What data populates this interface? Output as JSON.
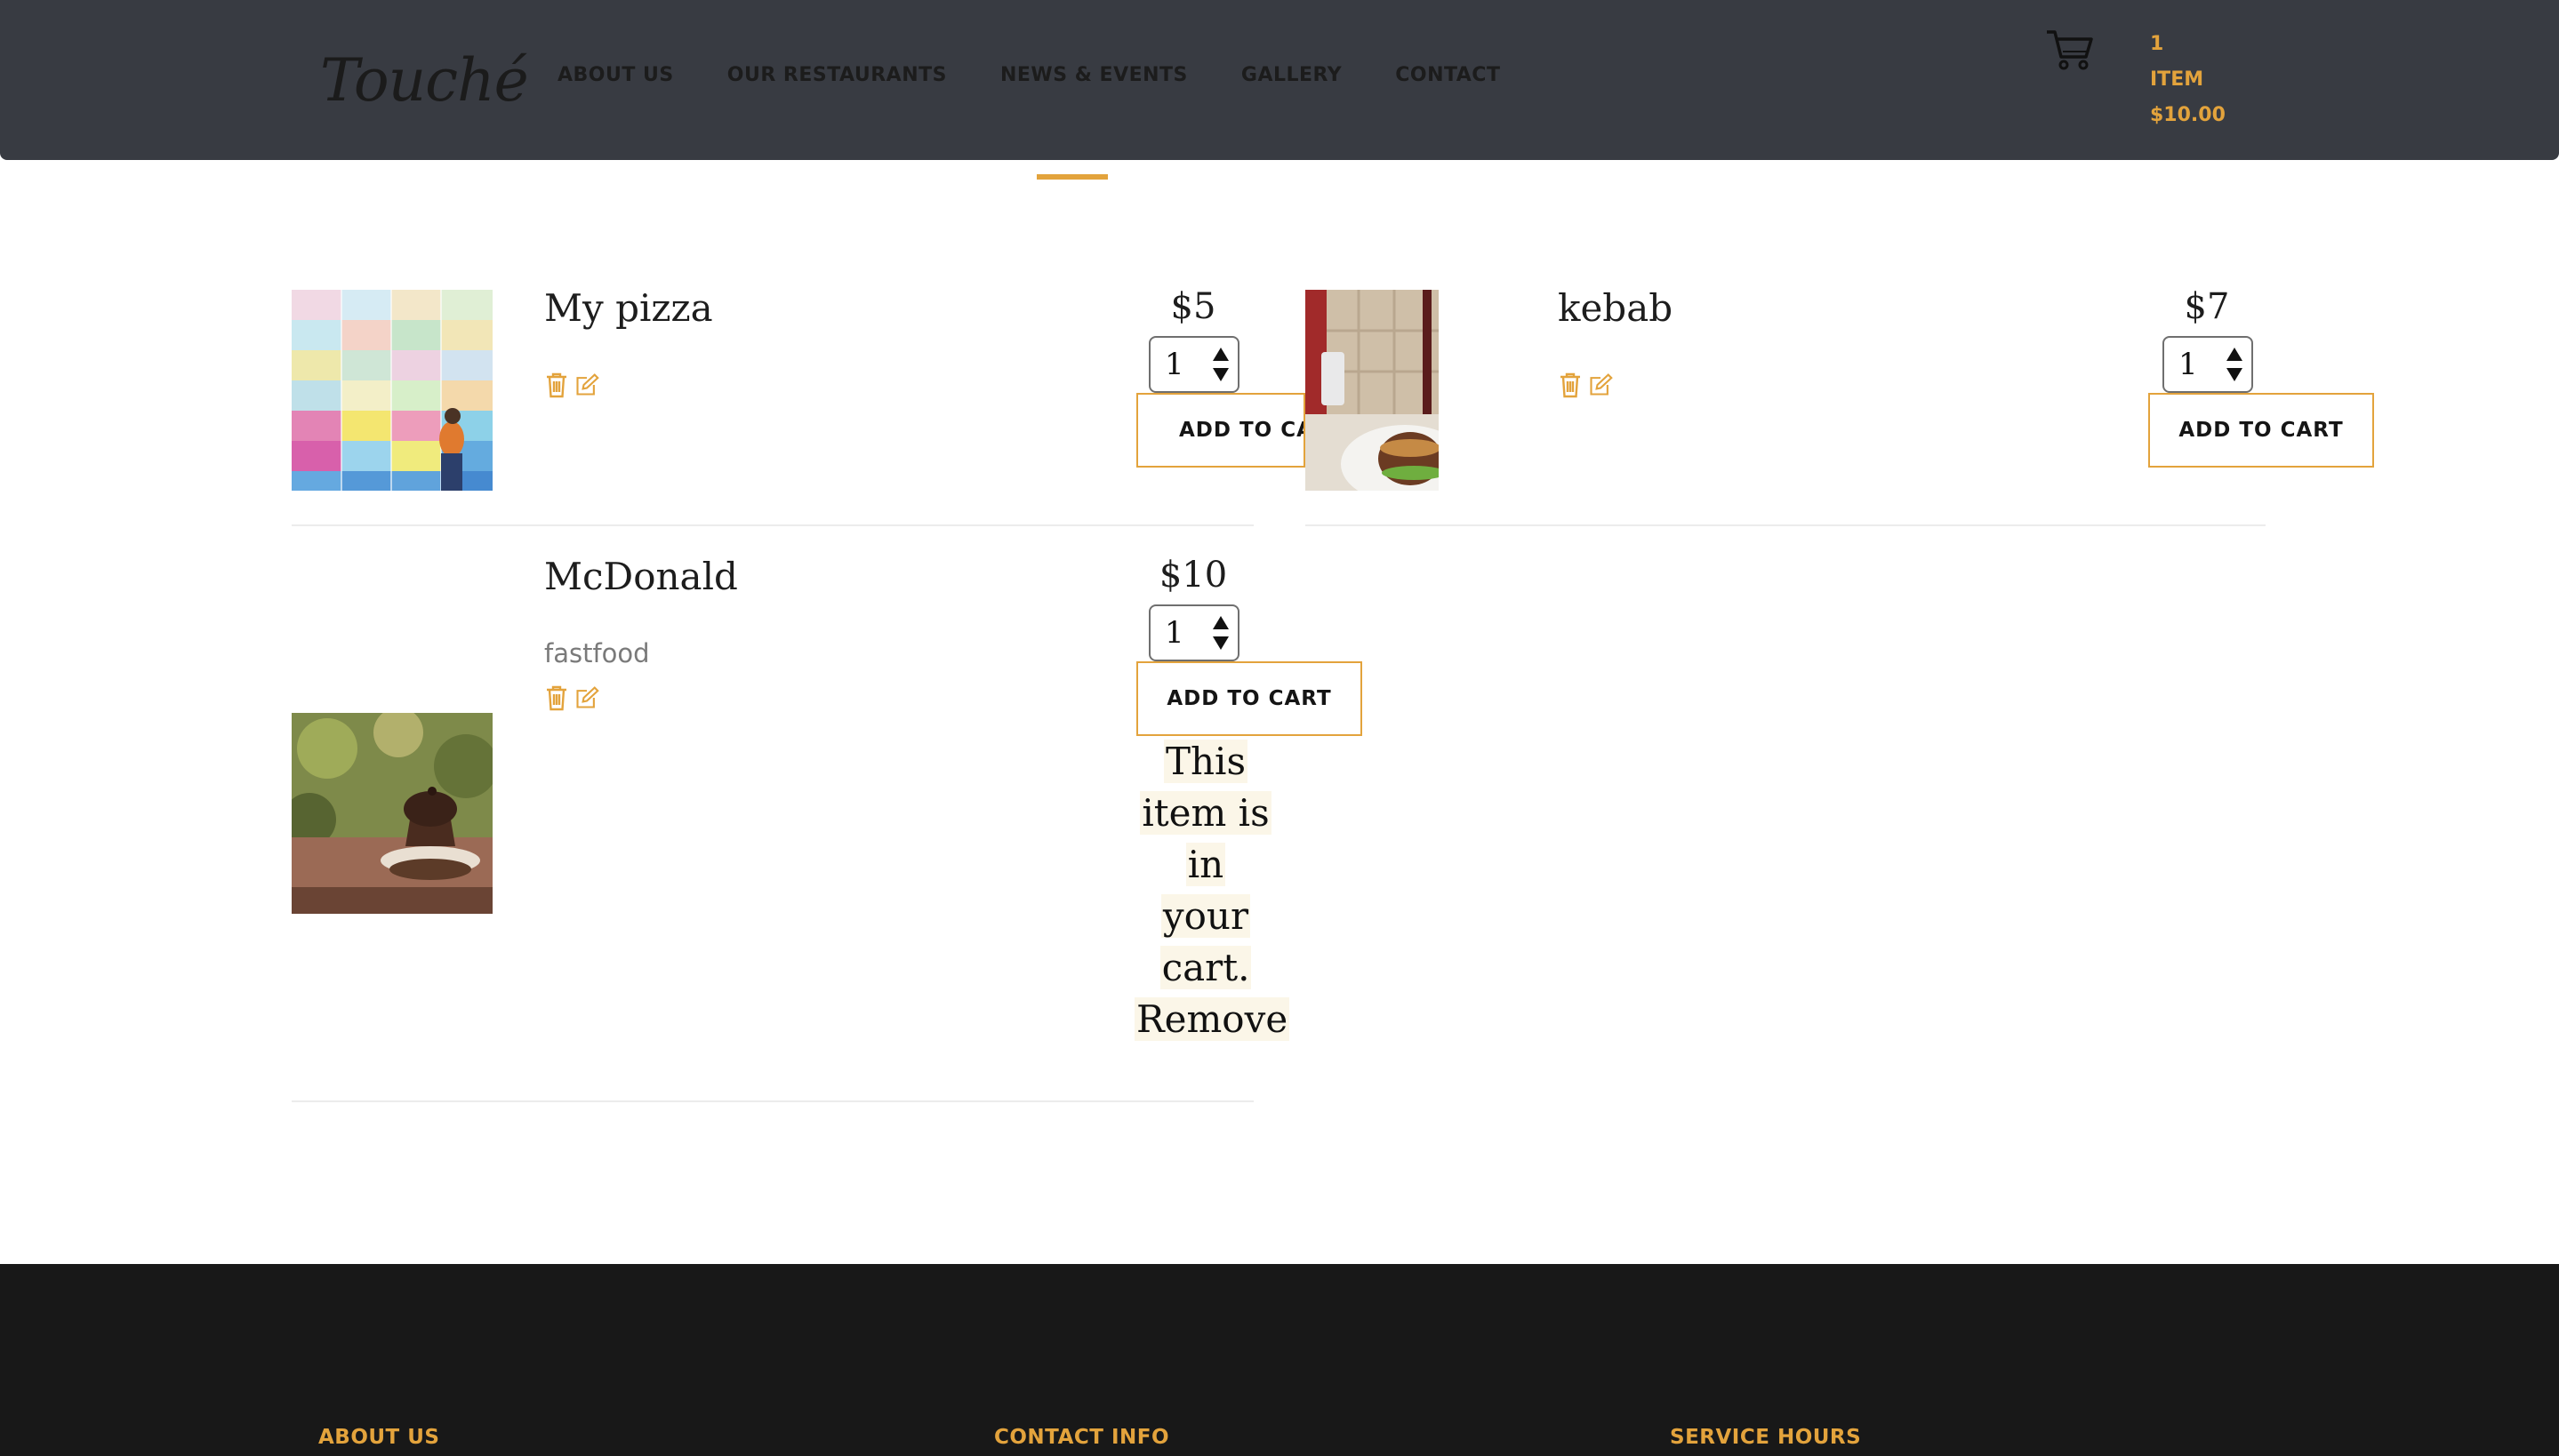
{
  "header": {
    "logo": "Touché",
    "nav": [
      "ABOUT US",
      "OUR RESTAURANTS",
      "NEWS & EVENTS",
      "GALLERY",
      "CONTACT"
    ],
    "cart": {
      "count": "1",
      "unit": "ITEM",
      "total": "$10.00"
    }
  },
  "products": [
    {
      "name": "My pizza",
      "description": "",
      "price": "$5",
      "quantity": "1",
      "button": "ADD TO CART"
    },
    {
      "name": "kebab",
      "description": "",
      "price": "$7",
      "quantity": "1",
      "button": "ADD TO CART"
    },
    {
      "name": "McDonald",
      "description": "fastfood",
      "price": "$10",
      "quantity": "1",
      "button": "ADD TO CART",
      "in_cart_notice": {
        "line1": "This",
        "line2": "item is",
        "line3": "in",
        "line4": "your",
        "line5": "cart.",
        "remove": "Remove"
      }
    }
  ],
  "footer": {
    "headings": [
      "ABOUT US",
      "CONTACT INFO",
      "SERVICE HOURS"
    ]
  },
  "colors": {
    "accent": "#e3a33c",
    "header_bg": "#383b42",
    "footer_bg": "#181818"
  },
  "icons": [
    "cart-icon",
    "trash-icon",
    "edit-icon"
  ]
}
